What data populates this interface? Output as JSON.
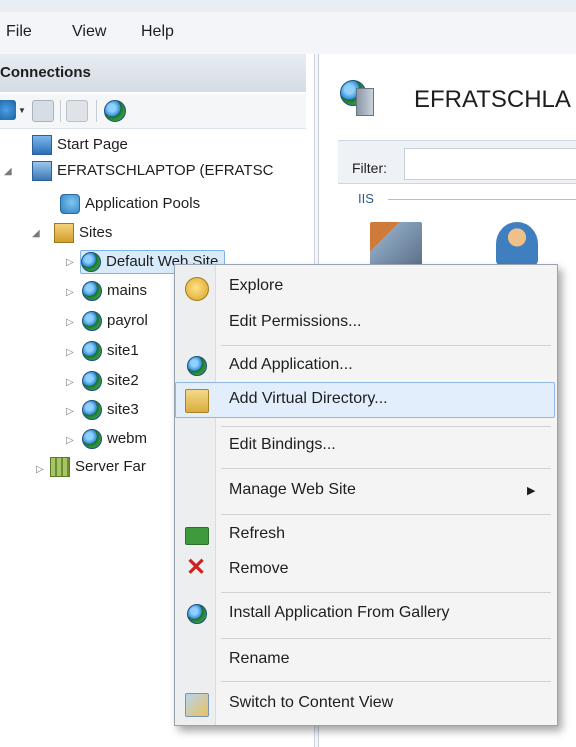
{
  "menubar": {
    "items": [
      "File",
      "View",
      "Help"
    ]
  },
  "connections": {
    "header": "Connections",
    "tree": {
      "start_page": "Start Page",
      "server": "EFRATSCHLAPTOP (EFRATSC",
      "app_pools": "Application Pools",
      "sites": "Sites",
      "site_nodes": [
        "Default Web Site",
        "mains",
        "payrol",
        "site1",
        "site2",
        "site3",
        "webm"
      ],
      "server_farms": "Server Far"
    }
  },
  "main": {
    "title": "EFRATSCHLA",
    "filter_label": "Filter:",
    "group_label": "IIS"
  },
  "context_menu": {
    "items": [
      "Explore",
      "Edit Permissions...",
      "Add Application...",
      "Add Virtual Directory...",
      "Edit Bindings...",
      "Manage Web Site",
      "Refresh",
      "Remove",
      "Install Application From Gallery",
      "Rename",
      "Switch to Content View"
    ],
    "highlighted": "Add Virtual Directory...",
    "submenu_arrow": "▶"
  },
  "colors": {
    "highlight": "#e2eefb",
    "highlight_border": "#8fb6e6",
    "remove_icon": "#d22020"
  }
}
